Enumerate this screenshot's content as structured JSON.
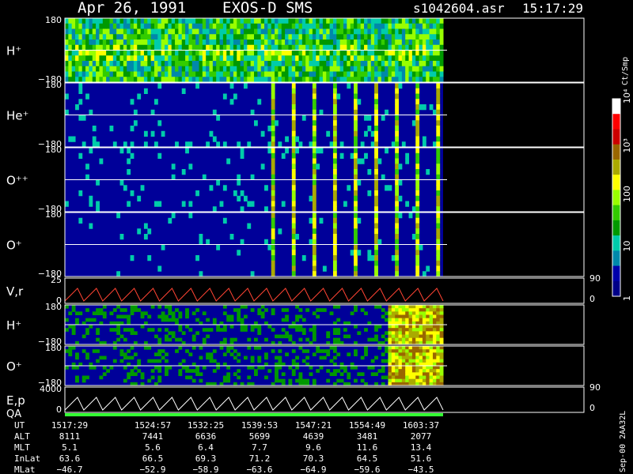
{
  "header": {
    "title": "Apr 26, 1991    EXOS-D SMS",
    "file": "s1042604.asr",
    "time": "15:17:29"
  },
  "colorbar": {
    "label": "Ct/Smp",
    "ticks": [
      "10⁴",
      "10³",
      "100",
      "10",
      "1"
    ],
    "colors": [
      "#ffffff",
      "#ff0000",
      "#cc0000",
      "#996600",
      "#aaaa00",
      "#ffff00",
      "#99ff00",
      "#33cc00",
      "#009900",
      "#00ccaa",
      "#0088aa",
      "#0000aa",
      "#000088"
    ]
  },
  "panels": [
    {
      "label": "H⁺",
      "ymax": "180",
      "ymin": "−180"
    },
    {
      "label": "He⁺",
      "ymax": "180",
      "ymin": "−180"
    },
    {
      "label": "O⁺⁺",
      "ymax": "180",
      "ymin": "−180"
    },
    {
      "label": "O⁺",
      "ymax": "180",
      "ymin": "−180"
    },
    {
      "label": "V,r",
      "ymax": "25",
      "ymin": "0",
      "right_max": "90",
      "right_min": "0"
    },
    {
      "label": "H⁺",
      "ymax": "180",
      "ymin": "−180"
    },
    {
      "label": "O⁺",
      "ymax": "180",
      "ymin": "−180"
    },
    {
      "label": "E,p",
      "label2": "QA",
      "ymax": "4000",
      "ymin": "0",
      "right_max": "90",
      "right_min": "0"
    }
  ],
  "footer": {
    "rows": [
      {
        "name": "UT",
        "values": [
          "1517:29",
          "1524:57",
          "1532:25",
          "1539:53",
          "1547:21",
          "1554:49",
          "1603:37"
        ]
      },
      {
        "name": "ALT",
        "values": [
          "8111",
          "7441",
          "6636",
          "5699",
          "4639",
          "3481",
          "2077"
        ]
      },
      {
        "name": "MLT",
        "values": [
          "5.1",
          "5.6",
          "6.4",
          "7.7",
          "9.6",
          "11.6",
          "13.4"
        ]
      },
      {
        "name": "InLat",
        "values": [
          "63.6",
          "66.5",
          "69.3",
          "71.2",
          "70.3",
          "64.5",
          "51.6"
        ]
      },
      {
        "name": "MLat",
        "values": [
          "−46.7",
          "−52.9",
          "−58.9",
          "−63.6",
          "−64.9",
          "−59.6",
          "−43.5"
        ]
      }
    ],
    "stamp": "Sep-00 2AA32L"
  },
  "chart_data": {
    "type": "heatmap",
    "ut_ticks": [
      "1517:29",
      "1524:57",
      "1532:25",
      "1539:53",
      "1547:21",
      "1554:49",
      "1603:37"
    ],
    "pitch_angle_range": [
      -180,
      180
    ],
    "count_scale": "log",
    "count_range": [
      1,
      10000
    ],
    "series": [
      {
        "name": "H⁺"
      },
      {
        "name": "He⁺"
      },
      {
        "name": "O⁺⁺"
      },
      {
        "name": "O⁺"
      },
      {
        "name": "V,r"
      },
      {
        "name": "H⁺"
      },
      {
        "name": "O⁺"
      },
      {
        "name": "E,p"
      }
    ]
  }
}
